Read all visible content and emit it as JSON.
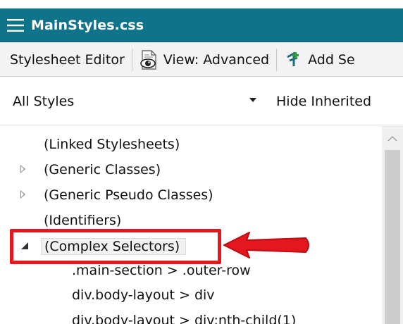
{
  "window": {
    "title": "MainStyles.css",
    "accent_color": "#0f7489"
  },
  "toolbar": {
    "editor_label": "Stylesheet Editor",
    "view_icon": "eye-document-icon",
    "view_label": "View: Advanced",
    "add_icon": "add-selector-icon",
    "add_label": "Add Se"
  },
  "filter": {
    "scope_value": "All Styles",
    "hide_inherited_label": "Hide Inherited"
  },
  "tree": {
    "items": [
      {
        "label": "(Linked Stylesheets)",
        "expander": "none"
      },
      {
        "label": "(Generic Classes)",
        "expander": "collapsed"
      },
      {
        "label": "(Generic Pseudo Classes)",
        "expander": "collapsed"
      },
      {
        "label": "(Identifiers)",
        "expander": "none"
      },
      {
        "label": "(Complex Selectors)",
        "expander": "expanded",
        "selected": true
      },
      {
        "label": ".main-section > .outer-row",
        "expander": "none"
      },
      {
        "label": "div.body-layout > div",
        "expander": "none"
      },
      {
        "label": "div.body-layout > div:nth-child(1)",
        "expander": "none"
      }
    ]
  },
  "annotation": {
    "highlight_color": "#e4161e"
  }
}
